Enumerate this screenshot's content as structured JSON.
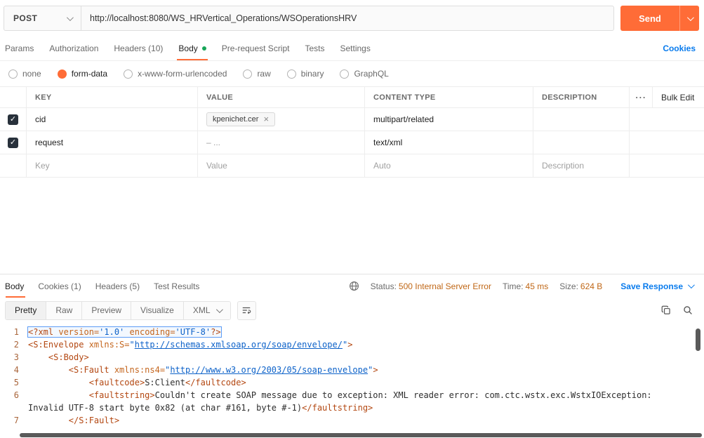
{
  "colors": {
    "accent_orange": "#ff6c37",
    "link_blue": "#097bed",
    "status_amber": "#c06716",
    "body_dot_green": "#18a558"
  },
  "request_bar": {
    "method": "POST",
    "url": "http://localhost:8080/WS_HRVertical_Operations/WSOperationsHRV",
    "send_label": "Send"
  },
  "request_tabs": {
    "params": "Params",
    "authorization": "Authorization",
    "headers": "Headers (10)",
    "body": "Body",
    "pre_request_script": "Pre-request Script",
    "tests": "Tests",
    "settings": "Settings",
    "cookies_link": "Cookies"
  },
  "body_type_options": {
    "none": "none",
    "form_data": "form-data",
    "urlencoded": "x-www-form-urlencoded",
    "raw": "raw",
    "binary": "binary",
    "graphql": "GraphQL",
    "selected": "form-data"
  },
  "form_table": {
    "col_key": "KEY",
    "col_value": "VALUE",
    "col_content_type": "CONTENT TYPE",
    "col_description": "DESCRIPTION",
    "bulk_edit_label": "Bulk Edit",
    "rows": [
      {
        "checked": true,
        "key": "cid",
        "file_value": "kpenichet.cer",
        "content_type": "multipart/related",
        "description": ""
      },
      {
        "checked": true,
        "key": "request",
        "value": "– ...",
        "content_type": "text/xml",
        "description": ""
      }
    ],
    "placeholder_row": {
      "key": "Key",
      "value": "Value",
      "content_type": "Auto",
      "description": "Description"
    }
  },
  "response": {
    "tabs": {
      "body": "Body",
      "cookies": "Cookies (1)",
      "headers": "Headers (5)",
      "test_results": "Test Results"
    },
    "meta": {
      "status_label": "Status:",
      "status_value": "500 Internal Server Error",
      "time_label": "Time:",
      "time_value": "45 ms",
      "size_label": "Size:",
      "size_value": "624 B"
    },
    "save_response_label": "Save Response",
    "view_tabs": {
      "pretty": "Pretty",
      "raw": "Raw",
      "preview": "Preview",
      "visualize": "Visualize"
    },
    "format_selector": "XML"
  },
  "code": {
    "lines": [
      {
        "num": "1",
        "highlight": true,
        "segments": [
          {
            "t": "<?xml ",
            "c": "tag"
          },
          {
            "t": "version=",
            "c": "attr"
          },
          {
            "t": "'1.0' ",
            "c": "str"
          },
          {
            "t": "encoding=",
            "c": "attr"
          },
          {
            "t": "'UTF-8'",
            "c": "str"
          },
          {
            "t": "?>",
            "c": "tag"
          }
        ]
      },
      {
        "num": "2",
        "segments": [
          {
            "t": "<S:Envelope ",
            "c": "tag"
          },
          {
            "t": "xmlns:S=",
            "c": "attr"
          },
          {
            "t": "\"",
            "c": "str"
          },
          {
            "t": "http://schemas.xmlsoap.org/soap/envelope/",
            "c": "link"
          },
          {
            "t": "\"",
            "c": "str"
          },
          {
            "t": ">",
            "c": "tag"
          }
        ]
      },
      {
        "num": "3",
        "segments": [
          {
            "t": "    <S:Body>",
            "c": "tag"
          }
        ]
      },
      {
        "num": "4",
        "segments": [
          {
            "t": "        <S:Fault ",
            "c": "tag"
          },
          {
            "t": "xmlns:ns4=",
            "c": "attr"
          },
          {
            "t": "\"",
            "c": "str"
          },
          {
            "t": "http://www.w3.org/2003/05/soap-envelope",
            "c": "link"
          },
          {
            "t": "\"",
            "c": "str"
          },
          {
            "t": ">",
            "c": "tag"
          }
        ]
      },
      {
        "num": "5",
        "segments": [
          {
            "t": "            <faultcode>",
            "c": "tag"
          },
          {
            "t": "S:Client",
            "c": "text"
          },
          {
            "t": "</faultcode>",
            "c": "tag"
          }
        ]
      },
      {
        "num": "6",
        "segments": [
          {
            "t": "            <faultstring>",
            "c": "tag"
          },
          {
            "t": "Couldn't create SOAP message due to exception: XML reader error: com.ctc.wstx.exc.WstxIOException: Invalid UTF-8 start byte 0x82 (at char #161, byte #-1)",
            "c": "text"
          },
          {
            "t": "</faultstring>",
            "c": "tag"
          }
        ]
      },
      {
        "num": "7",
        "segments": [
          {
            "t": "        </S:Fault>",
            "c": "tag"
          }
        ]
      }
    ]
  }
}
